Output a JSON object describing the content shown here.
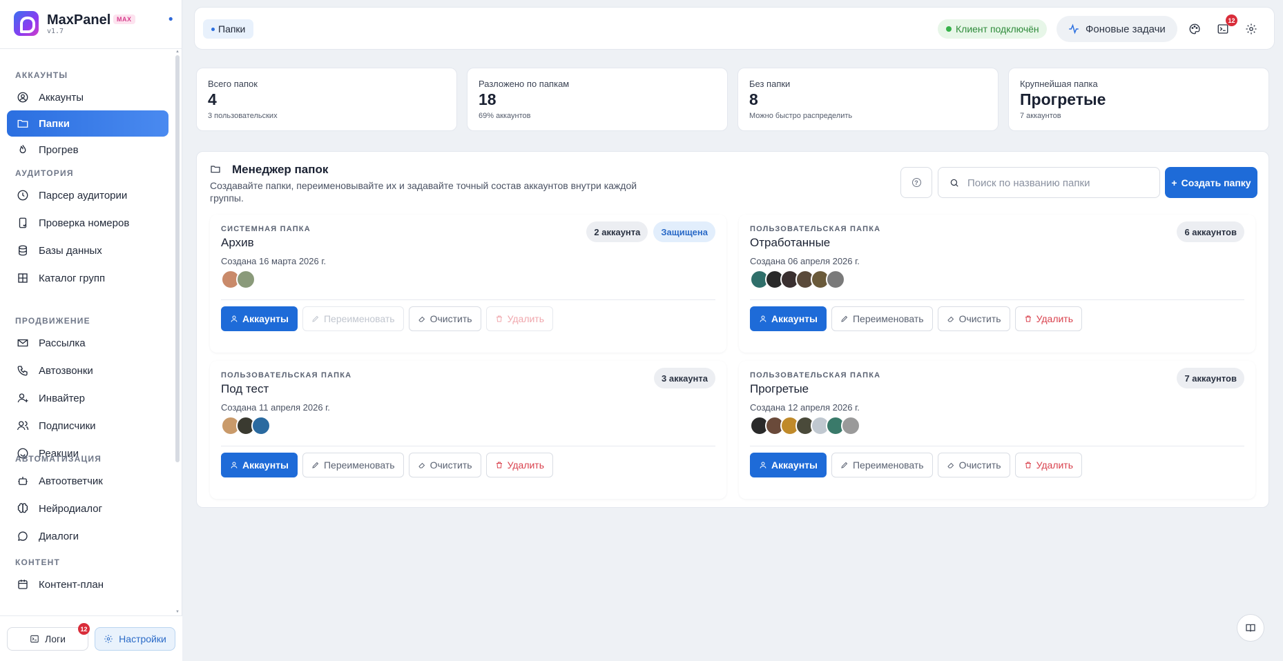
{
  "brand": {
    "name": "MaxPanel",
    "badge": "MAX",
    "version": "v1.7"
  },
  "sidebar": {
    "sections": [
      {
        "title": "АККАУНТЫ",
        "items": [
          {
            "label": "Аккаунты",
            "icon": "user-circle-icon"
          },
          {
            "label": "Папки",
            "icon": "folder-icon",
            "active": true
          },
          {
            "label": "Прогрев",
            "icon": "flame-icon"
          }
        ]
      },
      {
        "title": "АУДИТОРИЯ",
        "items": [
          {
            "label": "Парсер аудитории",
            "icon": "clock-icon"
          },
          {
            "label": "Проверка номеров",
            "icon": "phone-check-icon"
          },
          {
            "label": "Базы данных",
            "icon": "database-icon"
          },
          {
            "label": "Каталог групп",
            "icon": "grid-icon"
          }
        ]
      },
      {
        "title": "ПРОДВИЖЕНИЕ",
        "items": [
          {
            "label": "Рассылка",
            "icon": "send-icon"
          },
          {
            "label": "Автозвонки",
            "icon": "phone-icon"
          },
          {
            "label": "Инвайтер",
            "icon": "user-plus-icon"
          },
          {
            "label": "Подписчики",
            "icon": "users-icon"
          },
          {
            "label": "Реакции",
            "icon": "smile-icon"
          }
        ]
      },
      {
        "title": "АВТОМАТИЗАЦИЯ",
        "items": [
          {
            "label": "Автоответчик",
            "icon": "bot-icon"
          },
          {
            "label": "Нейродиалог",
            "icon": "brain-icon"
          },
          {
            "label": "Диалоги",
            "icon": "chat-icon"
          }
        ]
      },
      {
        "title": "КОНТЕНТ",
        "items": [
          {
            "label": "Контент-план",
            "icon": "calendar-icon"
          }
        ]
      }
    ],
    "bottom": {
      "logs_label": "Логи",
      "logs_count": "12",
      "settings_label": "Настройки"
    }
  },
  "topbar": {
    "breadcrumb": "Папки",
    "status": "Клиент подключён",
    "bg_tasks": "Фоновые задачи",
    "notif_count": "12"
  },
  "stats": [
    {
      "label": "Всего папок",
      "value": "4",
      "sub": "3 пользовательских"
    },
    {
      "label": "Разложено по папкам",
      "value": "18",
      "sub": "69% аккаунтов"
    },
    {
      "label": "Без папки",
      "value": "8",
      "sub": "Можно быстро распределить"
    },
    {
      "label": "Крупнейшая папка",
      "value": "Прогретые",
      "sub": "7 аккаунтов"
    }
  ],
  "manager": {
    "title": "Менеджер папок",
    "description": "Создавайте папки, переименовывайте их и задавайте точный состав аккаунтов внутри каждой группы.",
    "search_placeholder": "Поиск по названию папки",
    "search_value": "",
    "create_label": "Создать папку"
  },
  "folders": [
    {
      "kind": "СИСТЕМНАЯ ПАПКА",
      "name": "Архив",
      "created": "Создана 16 марта 2026 г.",
      "count": "2 аккаунта",
      "protected_label": "Защищена",
      "avatars": [
        "#c98a6a",
        "#8a9a7a"
      ],
      "locked": true
    },
    {
      "kind": "ПОЛЬЗОВАТЕЛЬСКАЯ ПАПКА",
      "name": "Отработанные",
      "created": "Создана 06 апреля 2026 г.",
      "count": "6 аккаунтов",
      "avatars": [
        "#2f6f6a",
        "#2a2a2a",
        "#3a3030",
        "#5a4a3a",
        "#6a5a3a",
        "#7a7a7a"
      ]
    },
    {
      "kind": "ПОЛЬЗОВАТЕЛЬСКАЯ ПАПКА",
      "name": "Под тест",
      "created": "Создана 11 апреля 2026 г.",
      "count": "3 аккаунта",
      "avatars": [
        "#c99a6a",
        "#3a3a30",
        "#2a6aa0"
      ]
    },
    {
      "kind": "ПОЛЬЗОВАТЕЛЬСКАЯ ПАПКА",
      "name": "Прогретые",
      "created": "Создана 12 апреля 2026 г.",
      "count": "7 аккаунтов",
      "avatars": [
        "#2a2a2a",
        "#6a4a3a",
        "#c08a2a",
        "#4a4a3a",
        "#c0c8d0",
        "#3a7a6a",
        "#9a9a9a"
      ]
    }
  ],
  "actions": {
    "accounts": "Аккаунты",
    "rename": "Переименовать",
    "clear": "Очистить",
    "delete": "Удалить"
  },
  "colors": {
    "accent": "#1e6bd8",
    "danger": "#d9414d",
    "success": "#36b24a"
  }
}
